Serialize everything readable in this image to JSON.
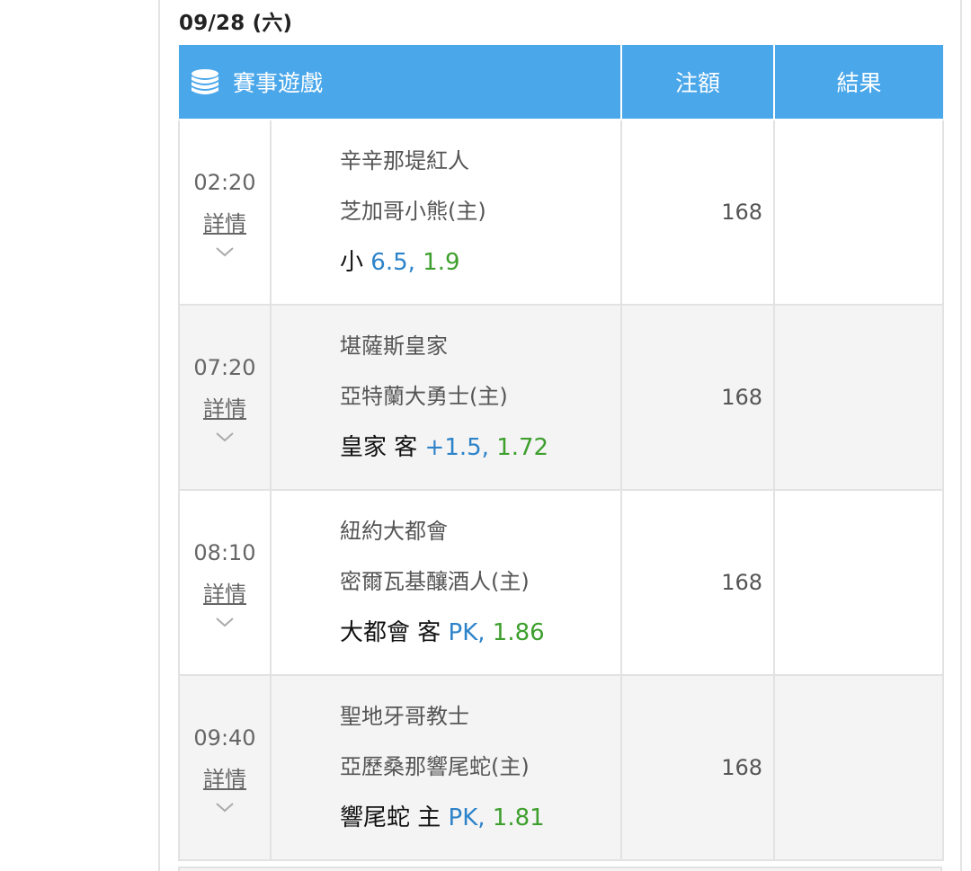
{
  "date_title": "09/28 (六)",
  "header": {
    "game_label": "賽事遊戲",
    "amount_label": "注額",
    "result_label": "結果",
    "game_icon": "coin-stack-icon"
  },
  "colors": {
    "header_bg": "#4aa7ea",
    "line_blue": "#2d83c9",
    "odds_green": "#3e9f2e"
  },
  "rows": [
    {
      "time": "02:20",
      "detail_label": "詳情",
      "away_team": "辛辛那堤紅人",
      "home_team": "芝加哥小熊(主)",
      "pick_side": "小",
      "pick_line": "6.5,",
      "pick_odds": "1.9",
      "amount": "168",
      "result": ""
    },
    {
      "time": "07:20",
      "detail_label": "詳情",
      "away_team": "堪薩斯皇家",
      "home_team": "亞特蘭大勇士(主)",
      "pick_side": "皇家 客",
      "pick_line": "+1.5,",
      "pick_odds": "1.72",
      "amount": "168",
      "result": ""
    },
    {
      "time": "08:10",
      "detail_label": "詳情",
      "away_team": "紐約大都會",
      "home_team": "密爾瓦基釀酒人(主)",
      "pick_side": "大都會 客",
      "pick_line": "PK,",
      "pick_odds": "1.86",
      "amount": "168",
      "result": ""
    },
    {
      "time": "09:40",
      "detail_label": "詳情",
      "away_team": "聖地牙哥教士",
      "home_team": "亞歷桑那響尾蛇(主)",
      "pick_side": "響尾蛇 主",
      "pick_line": "PK,",
      "pick_odds": "1.81",
      "amount": "168",
      "result": ""
    }
  ]
}
